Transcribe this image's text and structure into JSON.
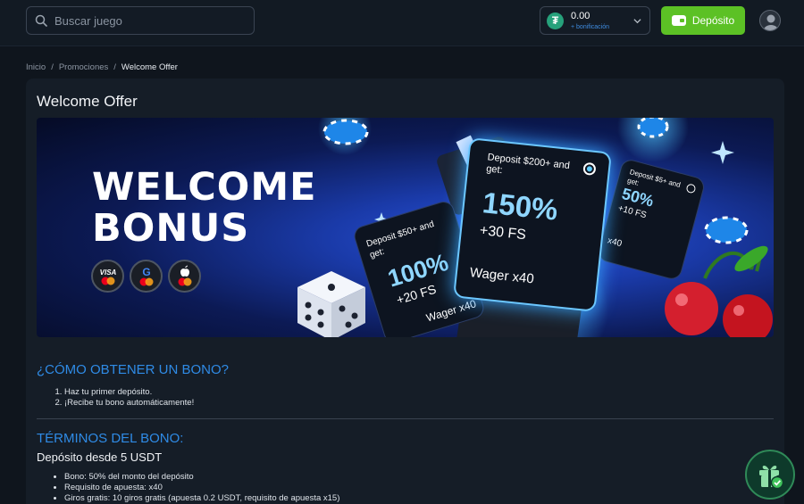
{
  "header": {
    "search_placeholder": "Buscar juego",
    "wallet": {
      "currency_icon": "tether-icon",
      "amount": "0.00",
      "bonus_label": "+ bonificación"
    },
    "deposit_label": "Depósito",
    "accent_color": "#5cc125"
  },
  "breadcrumb": {
    "items": [
      "Inicio",
      "Promociones",
      "Welcome Offer"
    ],
    "separator": "/"
  },
  "page": {
    "title": "Welcome Offer"
  },
  "banner": {
    "title_line1": "WELCOME",
    "title_line2": "BONUS",
    "payment_icons": [
      "visa-mastercard-icon",
      "google-pay-icon",
      "apple-pay-icon"
    ],
    "offers": [
      {
        "deposit": "Deposit $50+ and get:",
        "bonus": "100%",
        "fs": "+20 FS",
        "wager": "Wager x40"
      },
      {
        "deposit": "Deposit $200+ and get:",
        "bonus": "150%",
        "fs": "+30 FS",
        "wager": "Wager x40"
      },
      {
        "deposit": "Deposit $5+ and get:",
        "bonus": "50%",
        "fs": "+10 FS",
        "wager": "x40"
      }
    ]
  },
  "how_to": {
    "title": "¿CÓMO OBTENER UN BONO?",
    "steps": [
      "Haz tu primer depósito.",
      "¡Recibe tu bono automáticamente!"
    ]
  },
  "terms": {
    "title": "TÉRMINOS DEL BONO:",
    "subtitle": "Depósito desde 5 USDT",
    "items": [
      "Bono: 50% del monto del depósito",
      "Requisito de apuesta: x40",
      "Giros gratis: 10 giros gratis (apuesta 0.2 USDT, requisito de apuesta x15)"
    ],
    "accent_color": "#2f8be6"
  }
}
